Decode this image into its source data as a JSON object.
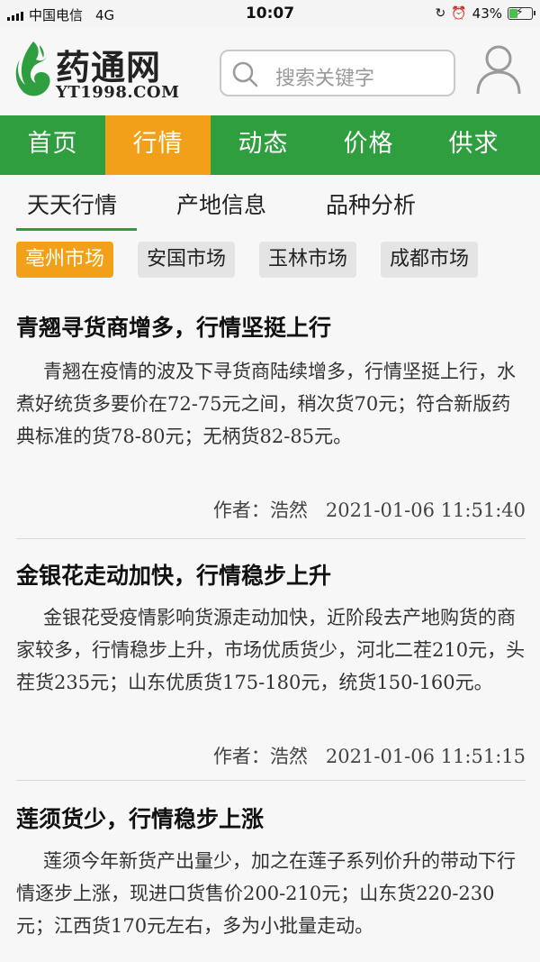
{
  "status_bar": {
    "carrier": "中国电信",
    "network": "4G",
    "time": "10:07",
    "battery_pct_text": "43%",
    "battery_level": 0.43
  },
  "header": {
    "logo_name": "药通网",
    "logo_sub": "YT1998.COM",
    "search_placeholder": "搜索关键字"
  },
  "nav": [
    {
      "label": "首页",
      "active": false
    },
    {
      "label": "行情",
      "active": true
    },
    {
      "label": "动态",
      "active": false
    },
    {
      "label": "价格",
      "active": false
    },
    {
      "label": "供求",
      "active": false
    }
  ],
  "tabs": [
    {
      "label": "天天行情",
      "active": true
    },
    {
      "label": "产地信息",
      "active": false
    },
    {
      "label": "品种分析",
      "active": false
    }
  ],
  "markets": [
    {
      "label": "亳州市场",
      "active": true
    },
    {
      "label": "安国市场",
      "active": false
    },
    {
      "label": "玉林市场",
      "active": false
    },
    {
      "label": "成都市场",
      "active": false
    }
  ],
  "articles": [
    {
      "title": "青翘寻货商增多，行情坚挺上行",
      "body": "青翘在疫情的波及下寻货商陆续增多，行情坚挺上行，水煮好统货多要价在72-75元之间，稍次货70元；符合新版药典标准的货78-80元；无柄货82-85元。",
      "author_label": "作者：",
      "author": "浩然",
      "datetime": "2021-01-06 11:51:40"
    },
    {
      "title": "金银花走动加快，行情稳步上升",
      "body": "金银花受疫情影响货源走动加快，近阶段去产地购货的商家较多，行情稳步上升，市场优质货少，河北二茬210元，头茬货235元；山东优质货175-180元，统货150-160元。",
      "author_label": "作者：",
      "author": "浩然",
      "datetime": "2021-01-06 11:51:15"
    },
    {
      "title": "莲须货少，行情稳步上涨",
      "body": "莲须今年新货产出量少，加之在莲子系列价升的带动下行情逐步上涨，现进口货售价200-210元；山东货220-230元；江西货170元左右，多为小批量走动。",
      "author_label": "",
      "author": "",
      "datetime": ""
    }
  ],
  "colors": {
    "brand_green": "#2e9e3e",
    "accent_orange": "#f2a01a"
  }
}
